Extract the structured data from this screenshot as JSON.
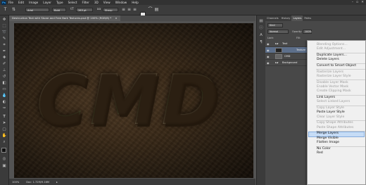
{
  "menubar": {
    "logo": "Ps",
    "items": [
      "File",
      "Edit",
      "Image",
      "Layer",
      "Type",
      "Select",
      "Filter",
      "3D",
      "View",
      "Window",
      "Help"
    ],
    "window_controls": [
      "–",
      "▫",
      "✕"
    ]
  },
  "options": {
    "font_family": "Arial",
    "font_style": "Bold",
    "font_size": "283 pt",
    "antialias": "Sharp",
    "color": "#e8e8e8"
  },
  "doc_tab": {
    "title": "Destruction Text with Stone and Free Bark Textures.psd @ 100% (RGB/8) *",
    "close": "×"
  },
  "canvas": {
    "text": "CMD"
  },
  "status": {
    "zoom": "100%",
    "doc": "Doc: 1.72M/9.16M"
  },
  "layers_panel": {
    "tabs": [
      "Channels",
      "History",
      "Layers",
      "Paths"
    ],
    "active_tab": "Layers",
    "kind_label": "Kind",
    "blend_mode": "Normal",
    "opacity_label": "Opacity:",
    "opacity_value": "100%",
    "lock_label": "Lock:",
    "fill_label": "Fill:",
    "layers": [
      {
        "name": "Text",
        "group": true
      },
      {
        "name": "Texture",
        "selected": true
      },
      {
        "name": "CMD"
      },
      {
        "name": "Background",
        "group": true
      }
    ]
  },
  "context_menu": {
    "items": [
      {
        "label": "Blending Options...",
        "disabled": true
      },
      {
        "label": "Edit Adjustment...",
        "disabled": true
      },
      {
        "sep": true
      },
      {
        "label": "Duplicate Layers...",
        "disabled": false
      },
      {
        "label": "Delete Layers",
        "disabled": false
      },
      {
        "sep": true
      },
      {
        "label": "Convert to Smart Object",
        "disabled": false
      },
      {
        "sep": true
      },
      {
        "label": "Rasterize Layers",
        "disabled": true
      },
      {
        "label": "Rasterize Layer Style",
        "disabled": true
      },
      {
        "sep": true
      },
      {
        "label": "Disable Layer Mask",
        "disabled": true
      },
      {
        "label": "Enable Vector Mask",
        "disabled": true
      },
      {
        "label": "Create Clipping Mask",
        "disabled": true
      },
      {
        "sep": true
      },
      {
        "label": "Link Layers",
        "disabled": false
      },
      {
        "label": "Select Linked Layers",
        "disabled": true
      },
      {
        "sep": true
      },
      {
        "label": "Copy Layer Style",
        "disabled": true
      },
      {
        "label": "Paste Layer Style",
        "disabled": false
      },
      {
        "label": "Clear Layer Style",
        "disabled": true
      },
      {
        "sep": true
      },
      {
        "label": "Copy Shape Attributes",
        "disabled": true
      },
      {
        "label": "Paste Shape Attributes",
        "disabled": true
      },
      {
        "sep": true
      },
      {
        "label": "Merge Layers",
        "disabled": false,
        "highlighted": true
      },
      {
        "label": "Merge Visible",
        "disabled": false
      },
      {
        "label": "Flatten Image",
        "disabled": false
      },
      {
        "sep": true
      },
      {
        "label": "No Color",
        "disabled": false
      },
      {
        "label": "Red",
        "disabled": false
      }
    ]
  },
  "colors": {
    "highlight": "#c6dcf6",
    "selected_layer": "#5d6f8a"
  }
}
